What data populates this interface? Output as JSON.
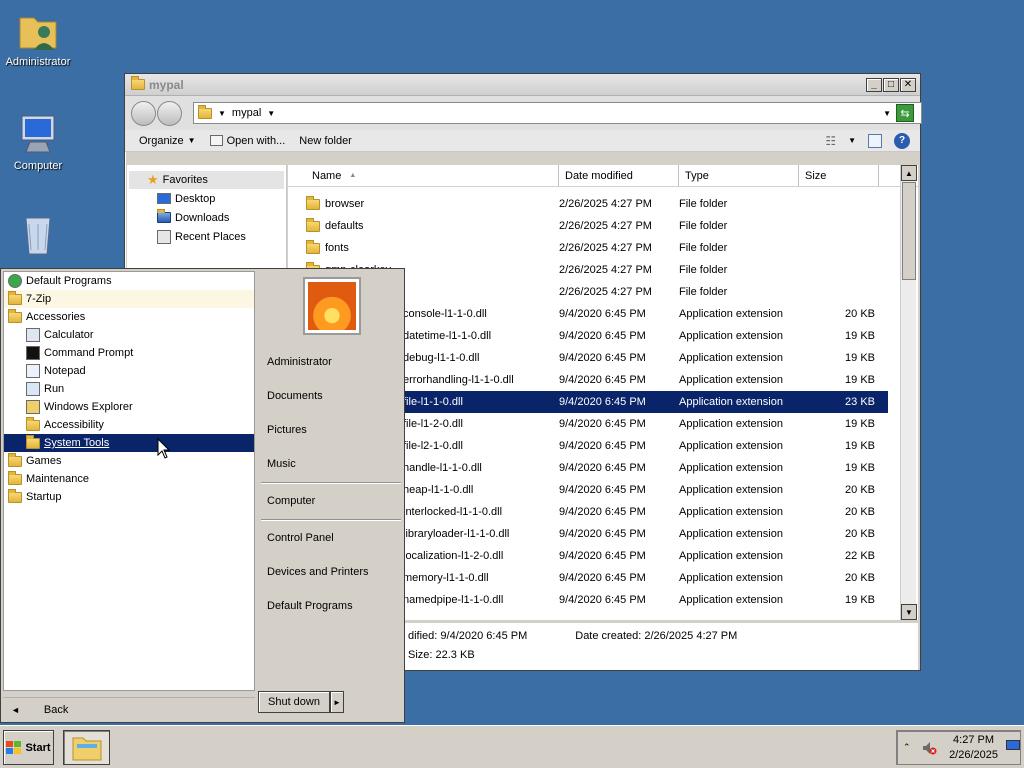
{
  "desktop": {
    "icons": [
      {
        "label": "Administrator",
        "icon": "user-folder-icon"
      },
      {
        "label": "Computer",
        "icon": "computer-icon"
      },
      {
        "label": "",
        "icon": "recycle-bin-icon"
      }
    ]
  },
  "explorer": {
    "title": "mypal",
    "address": "mypal",
    "toolbar": {
      "organize": "Organize",
      "open_with": "Open with...",
      "new_folder": "New folder"
    },
    "nav": {
      "favorites": "Favorites",
      "items": [
        "Desktop",
        "Downloads",
        "Recent Places"
      ]
    },
    "columns": [
      "Name",
      "Date modified",
      "Type",
      "Size"
    ],
    "rows": [
      {
        "name": "browser",
        "date": "2/26/2025 4:27 PM",
        "type": "File folder",
        "size": "",
        "kind": "folder"
      },
      {
        "name": "defaults",
        "date": "2/26/2025 4:27 PM",
        "type": "File folder",
        "size": "",
        "kind": "folder"
      },
      {
        "name": "fonts",
        "date": "2/26/2025 4:27 PM",
        "type": "File folder",
        "size": "",
        "kind": "folder"
      },
      {
        "name": "gmp-clearkey",
        "date": "2/26/2025 4:27 PM",
        "type": "File folder",
        "size": "",
        "kind": "folder"
      },
      {
        "name": "",
        "date": "2/26/2025 4:27 PM",
        "type": "File folder",
        "size": "",
        "kind": "folder"
      },
      {
        "name": "console-l1-1-0.dll",
        "date": "9/4/2020 6:45 PM",
        "type": "Application extension",
        "size": "20 KB",
        "kind": "dll"
      },
      {
        "name": "datetime-l1-1-0.dll",
        "date": "9/4/2020 6:45 PM",
        "type": "Application extension",
        "size": "19 KB",
        "kind": "dll"
      },
      {
        "name": "debug-l1-1-0.dll",
        "date": "9/4/2020 6:45 PM",
        "type": "Application extension",
        "size": "19 KB",
        "kind": "dll"
      },
      {
        "name": "errorhandling-l1-1-0.dll",
        "date": "9/4/2020 6:45 PM",
        "type": "Application extension",
        "size": "19 KB",
        "kind": "dll"
      },
      {
        "name": "file-l1-1-0.dll",
        "date": "9/4/2020 6:45 PM",
        "type": "Application extension",
        "size": "23 KB",
        "kind": "dll",
        "selected": true
      },
      {
        "name": "file-l1-2-0.dll",
        "date": "9/4/2020 6:45 PM",
        "type": "Application extension",
        "size": "19 KB",
        "kind": "dll"
      },
      {
        "name": "file-l2-1-0.dll",
        "date": "9/4/2020 6:45 PM",
        "type": "Application extension",
        "size": "19 KB",
        "kind": "dll"
      },
      {
        "name": "handle-l1-1-0.dll",
        "date": "9/4/2020 6:45 PM",
        "type": "Application extension",
        "size": "19 KB",
        "kind": "dll"
      },
      {
        "name": "heap-l1-1-0.dll",
        "date": "9/4/2020 6:45 PM",
        "type": "Application extension",
        "size": "20 KB",
        "kind": "dll"
      },
      {
        "name": "interlocked-l1-1-0.dll",
        "date": "9/4/2020 6:45 PM",
        "type": "Application extension",
        "size": "20 KB",
        "kind": "dll"
      },
      {
        "name": "libraryloader-l1-1-0.dll",
        "date": "9/4/2020 6:45 PM",
        "type": "Application extension",
        "size": "20 KB",
        "kind": "dll"
      },
      {
        "name": "localization-l1-2-0.dll",
        "date": "9/4/2020 6:45 PM",
        "type": "Application extension",
        "size": "22 KB",
        "kind": "dll"
      },
      {
        "name": "memory-l1-1-0.dll",
        "date": "9/4/2020 6:45 PM",
        "type": "Application extension",
        "size": "20 KB",
        "kind": "dll"
      },
      {
        "name": "namedpipe-l1-1-0.dll",
        "date": "9/4/2020 6:45 PM",
        "type": "Application extension",
        "size": "19 KB",
        "kind": "dll"
      }
    ],
    "details": {
      "modified": "dified: 9/4/2020 6:45 PM",
      "created": "Date created: 2/26/2025 4:27 PM",
      "size": "Size: 22.3 KB"
    }
  },
  "startmenu": {
    "programs": [
      {
        "label": "Default Programs",
        "indent": false,
        "icon": "default-programs-icon"
      },
      {
        "label": "7-Zip",
        "indent": false,
        "icon": "folder-icon",
        "highlight": true
      },
      {
        "label": "Accessories",
        "indent": false,
        "icon": "folder-icon"
      },
      {
        "label": "Calculator",
        "indent": true,
        "icon": "calculator-icon"
      },
      {
        "label": "Command Prompt",
        "indent": true,
        "icon": "command-prompt-icon"
      },
      {
        "label": "Notepad",
        "indent": true,
        "icon": "notepad-icon"
      },
      {
        "label": "Run",
        "indent": true,
        "icon": "run-icon"
      },
      {
        "label": "Windows Explorer",
        "indent": true,
        "icon": "windows-explorer-icon"
      },
      {
        "label": "Accessibility",
        "indent": true,
        "icon": "folder-icon"
      },
      {
        "label": "System Tools",
        "indent": true,
        "icon": "folder-icon",
        "selected": true
      },
      {
        "label": "Games",
        "indent": false,
        "icon": "folder-icon"
      },
      {
        "label": "Maintenance",
        "indent": false,
        "icon": "folder-icon"
      },
      {
        "label": "Startup",
        "indent": false,
        "icon": "folder-icon"
      }
    ],
    "back": "Back",
    "right_links": [
      "Administrator",
      "Documents",
      "Pictures",
      "Music",
      "Computer",
      "Control Panel",
      "Devices and Printers",
      "Default Programs"
    ],
    "shutdown": "Shut down"
  },
  "taskbar": {
    "start": "Start",
    "time": "4:27 PM",
    "date": "2/26/2025"
  }
}
